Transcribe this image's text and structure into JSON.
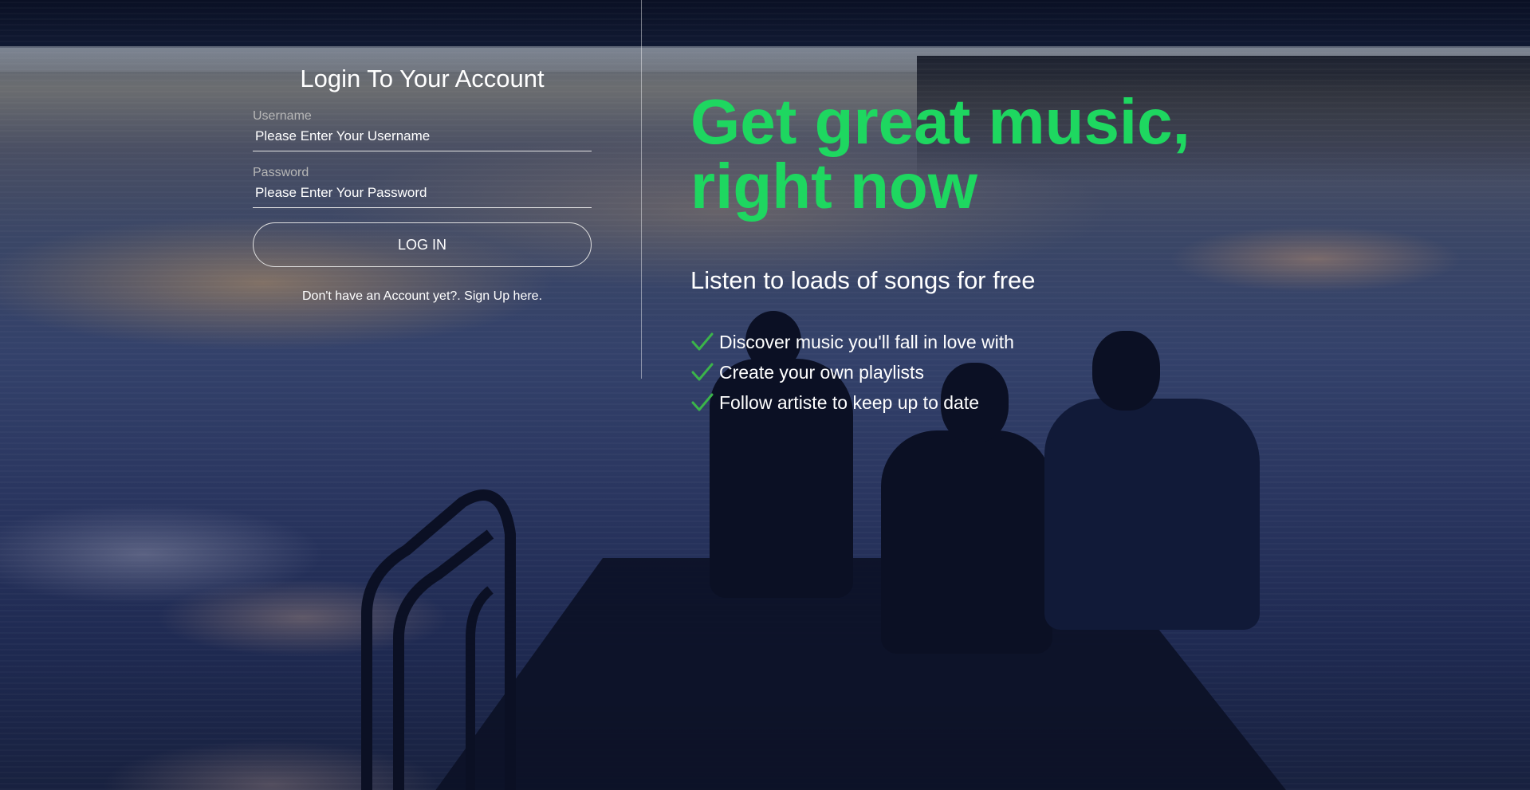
{
  "login": {
    "title": "Login To Your Account",
    "username_label": "Username",
    "username_placeholder": "Please Enter Your Username",
    "password_label": "Password",
    "password_placeholder": "Please Enter Your Password",
    "button_label": "LOG IN",
    "signup_prompt": "Don't have an Account yet?. Sign Up here."
  },
  "promo": {
    "headline_line1": "Get great music,",
    "headline_line2": "right now",
    "subhead": "Listen to loads of songs for free",
    "features": [
      "Discover music you'll fall in love with",
      "Create your own playlists",
      "Follow artiste to keep up to date"
    ]
  },
  "colors": {
    "accent": "#1ed760",
    "check": "#3bb44a",
    "text": "#ffffff"
  },
  "icons": {
    "feature_bullet": "check-icon"
  }
}
